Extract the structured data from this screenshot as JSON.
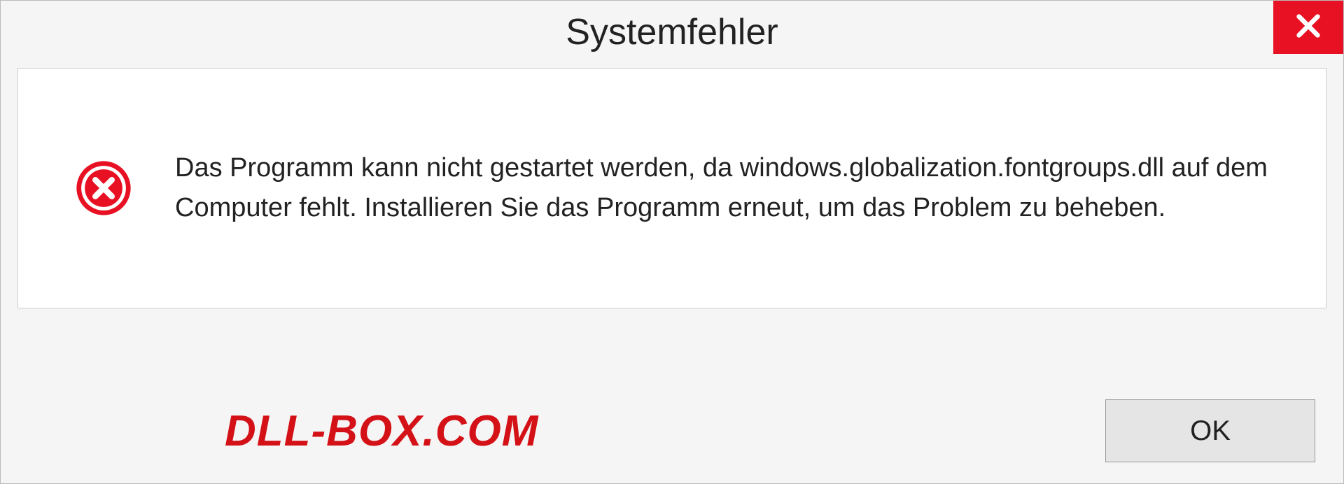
{
  "dialog": {
    "title": "Systemfehler",
    "message": "Das Programm kann nicht gestartet werden, da windows.globalization.fontgroups.dll auf dem Computer fehlt. Installieren Sie das Programm erneut, um das Problem zu beheben.",
    "ok_label": "OK"
  },
  "watermark": "DLL-BOX.COM"
}
